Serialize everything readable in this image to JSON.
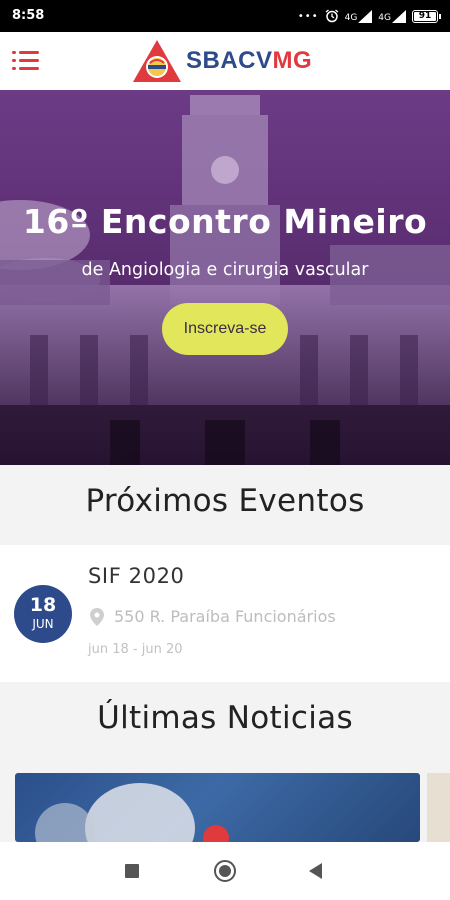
{
  "status_bar": {
    "time": "8:58",
    "icons": [
      "more-dots-icon",
      "alarm-icon",
      "signal-4g-icon",
      "signal-4g-icon",
      "battery-icon"
    ],
    "net_label_1": "4G",
    "net_label_2": "4G",
    "battery_level": "91"
  },
  "app_bar": {
    "logo_text_primary": "SBACV",
    "logo_text_accent": "MG",
    "brand_blue": "#2d4a8a",
    "brand_red": "#e0393e"
  },
  "hero": {
    "title": "16º Encontro Mineiro",
    "subtitle": "de Angiologia e cirurgia vascular",
    "cta_label": "Inscreva-se",
    "cta_color": "#e2e65a"
  },
  "upcoming": {
    "section_title": "Próximos Eventos",
    "events": [
      {
        "day": "18",
        "month": "JUN",
        "name": "SIF 2020",
        "location": "550 R. Paraíba Funcionários",
        "dates": "jun 18 - jun 20"
      }
    ]
  },
  "news": {
    "section_title": "Últimas Noticias"
  },
  "nav_bar": {
    "buttons": [
      "recents-icon",
      "home-icon",
      "back-icon"
    ]
  }
}
